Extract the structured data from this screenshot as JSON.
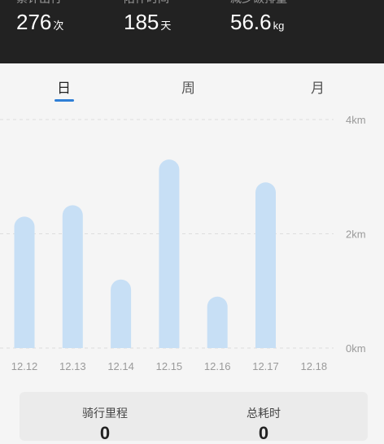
{
  "stats": [
    {
      "label": "累计出行",
      "value": "276",
      "unit": "次"
    },
    {
      "label": "陪伴时间",
      "value": "185",
      "unit": "天"
    },
    {
      "label": "减少碳排量",
      "value": "56.6",
      "unit": "kg"
    }
  ],
  "tabs": [
    {
      "label": "日",
      "active": true
    },
    {
      "label": "周",
      "active": false
    },
    {
      "label": "月",
      "active": false
    }
  ],
  "summary": [
    {
      "label": "骑行里程",
      "value": "0"
    },
    {
      "label": "总耗时",
      "value": "0"
    }
  ],
  "colors": {
    "bar": "#c7dff5",
    "accent": "#2f7fd6",
    "grid": "#dddddd",
    "axis_text": "#9a9a9a",
    "header_bg": "#222222"
  },
  "chart_data": {
    "type": "bar",
    "categories": [
      "12.12",
      "12.13",
      "12.14",
      "12.15",
      "12.16",
      "12.17",
      "12.18"
    ],
    "values": [
      2.3,
      2.5,
      1.2,
      3.3,
      0.9,
      2.9,
      0
    ],
    "y_ticks": [
      "0km",
      "2km",
      "4km"
    ],
    "ylim": [
      0,
      4
    ],
    "grid": true
  }
}
